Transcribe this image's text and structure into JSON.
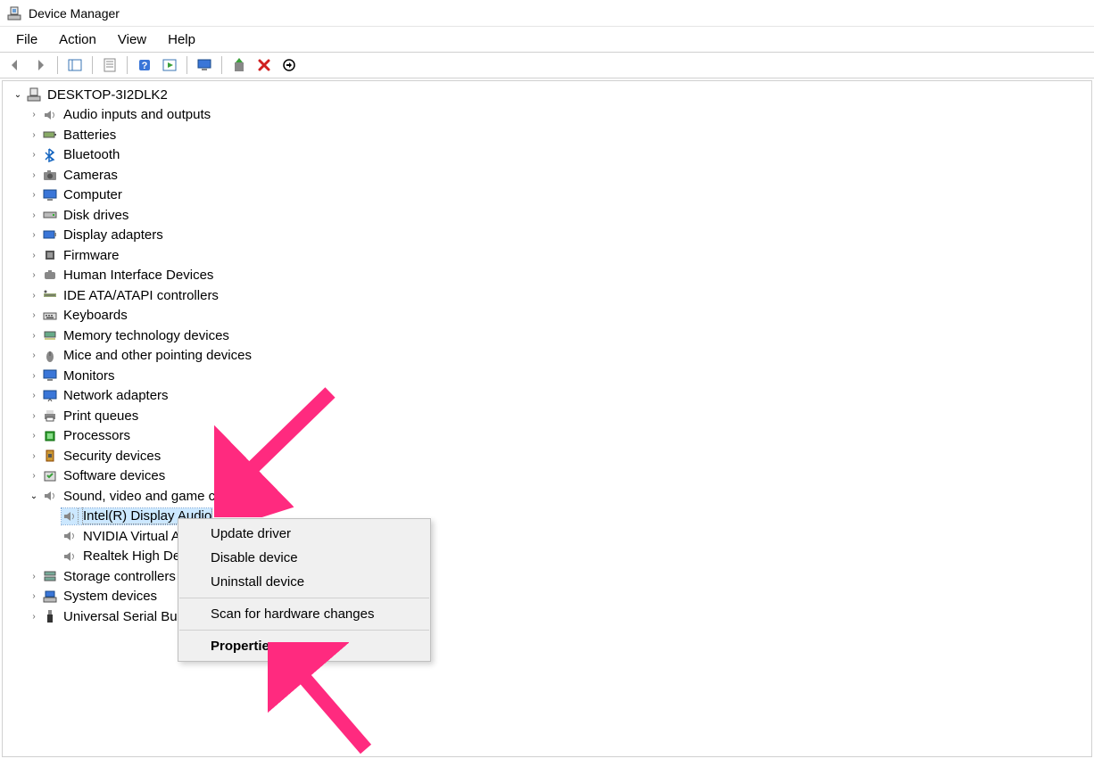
{
  "window": {
    "title": "Device Manager"
  },
  "menubar": {
    "file": "File",
    "action": "Action",
    "view": "View",
    "help": "Help"
  },
  "toolbar": {
    "back": "back-icon",
    "forward": "forward-icon",
    "show_hide": "show-hide-tree-icon",
    "properties": "properties-icon",
    "help": "help-icon",
    "action": "action-icon",
    "remote": "remote-computer-icon",
    "update": "update-driver-icon",
    "uninstall": "uninstall-icon",
    "scan": "scan-hardware-icon"
  },
  "tree": {
    "root": "DESKTOP-3I2DLK2",
    "categories": [
      {
        "label": "Audio inputs and outputs",
        "icon": "speaker-icon"
      },
      {
        "label": "Batteries",
        "icon": "battery-icon"
      },
      {
        "label": "Bluetooth",
        "icon": "bluetooth-icon"
      },
      {
        "label": "Cameras",
        "icon": "camera-icon"
      },
      {
        "label": "Computer",
        "icon": "monitor-icon"
      },
      {
        "label": "Disk drives",
        "icon": "disk-icon"
      },
      {
        "label": "Display adapters",
        "icon": "display-adapter-icon"
      },
      {
        "label": "Firmware",
        "icon": "firmware-icon"
      },
      {
        "label": "Human Interface Devices",
        "icon": "hid-icon"
      },
      {
        "label": "IDE ATA/ATAPI controllers",
        "icon": "ide-icon"
      },
      {
        "label": "Keyboards",
        "icon": "keyboard-icon"
      },
      {
        "label": "Memory technology devices",
        "icon": "memory-icon"
      },
      {
        "label": "Mice and other pointing devices",
        "icon": "mouse-icon"
      },
      {
        "label": "Monitors",
        "icon": "monitor-icon"
      },
      {
        "label": "Network adapters",
        "icon": "network-icon"
      },
      {
        "label": "Print queues",
        "icon": "printer-icon"
      },
      {
        "label": "Processors",
        "icon": "processor-icon"
      },
      {
        "label": "Security devices",
        "icon": "security-icon"
      },
      {
        "label": "Software devices",
        "icon": "software-icon"
      }
    ],
    "expanded_category": {
      "label": "Sound, video and game controllers",
      "icon": "speaker-icon",
      "children": [
        {
          "label": "Intel(R) Display Audio",
          "icon": "speaker-icon",
          "selected": true
        },
        {
          "label": "NVIDIA Virtual Audio Device (Wave Extensible) (WDM)",
          "icon": "speaker-icon"
        },
        {
          "label": "Realtek High Definition Audio",
          "icon": "speaker-icon"
        }
      ]
    },
    "after_categories": [
      {
        "label": "Storage controllers",
        "icon": "storage-icon"
      },
      {
        "label": "System devices",
        "icon": "system-icon"
      },
      {
        "label": "Universal Serial Bus controllers",
        "icon": "usb-icon"
      }
    ]
  },
  "context_menu": {
    "update": "Update driver",
    "disable": "Disable device",
    "uninstall": "Uninstall device",
    "scan": "Scan for hardware changes",
    "properties": "Properties"
  }
}
